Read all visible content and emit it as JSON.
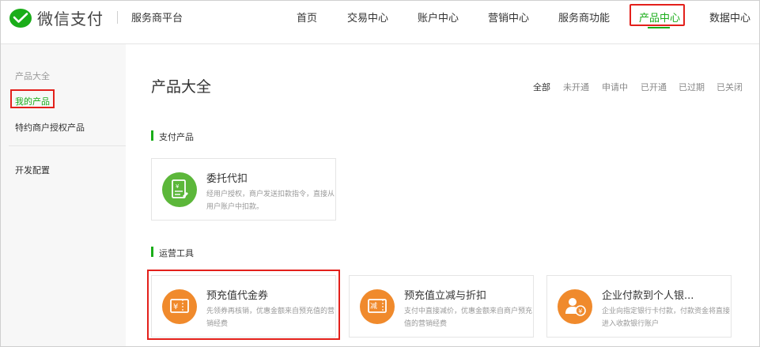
{
  "brand": {
    "name": "微信支付",
    "platform": "服务商平台"
  },
  "nav": [
    {
      "label": "首页"
    },
    {
      "label": "交易中心"
    },
    {
      "label": "账户中心"
    },
    {
      "label": "营销中心"
    },
    {
      "label": "服务商功能"
    },
    {
      "label": "产品中心",
      "active": true
    },
    {
      "label": "数据中心"
    }
  ],
  "sidebar": {
    "heading": "产品大全",
    "items": [
      {
        "label": "我的产品",
        "active": true
      },
      {
        "label": "特约商户授权产品"
      },
      {
        "label": "开发配置"
      }
    ]
  },
  "main": {
    "title": "产品大全",
    "filters": [
      "全部",
      "未开通",
      "申请中",
      "已开通",
      "已过期",
      "已关闭"
    ],
    "sections": [
      {
        "label": "支付产品",
        "cards": [
          {
            "title": "委托代扣",
            "desc": "经用户授权，商户发送扣款指令，直接从用户账户中扣款。",
            "icon": "document-yen-icon",
            "color": "#5cb73a"
          }
        ]
      },
      {
        "label": "运营工具",
        "cards": [
          {
            "title": "预充值代金券",
            "desc": "先领券再核销，优惠金额来自预充值的营销经费",
            "icon": "yen-ticket-icon",
            "color": "#f08a2c"
          },
          {
            "title": "预充值立减与折扣",
            "desc": "支付中直接减价，优惠金额来自商户预充值的营销经费",
            "icon": "discount-ticket-icon",
            "color": "#f08a2c",
            "glyph": "减"
          },
          {
            "title": "企业付款到个人银...",
            "desc": "企业向指定银行卡付款，付款资金将直接进入收款银行账户",
            "icon": "person-payment-icon",
            "color": "#f08a2c"
          }
        ]
      }
    ]
  }
}
